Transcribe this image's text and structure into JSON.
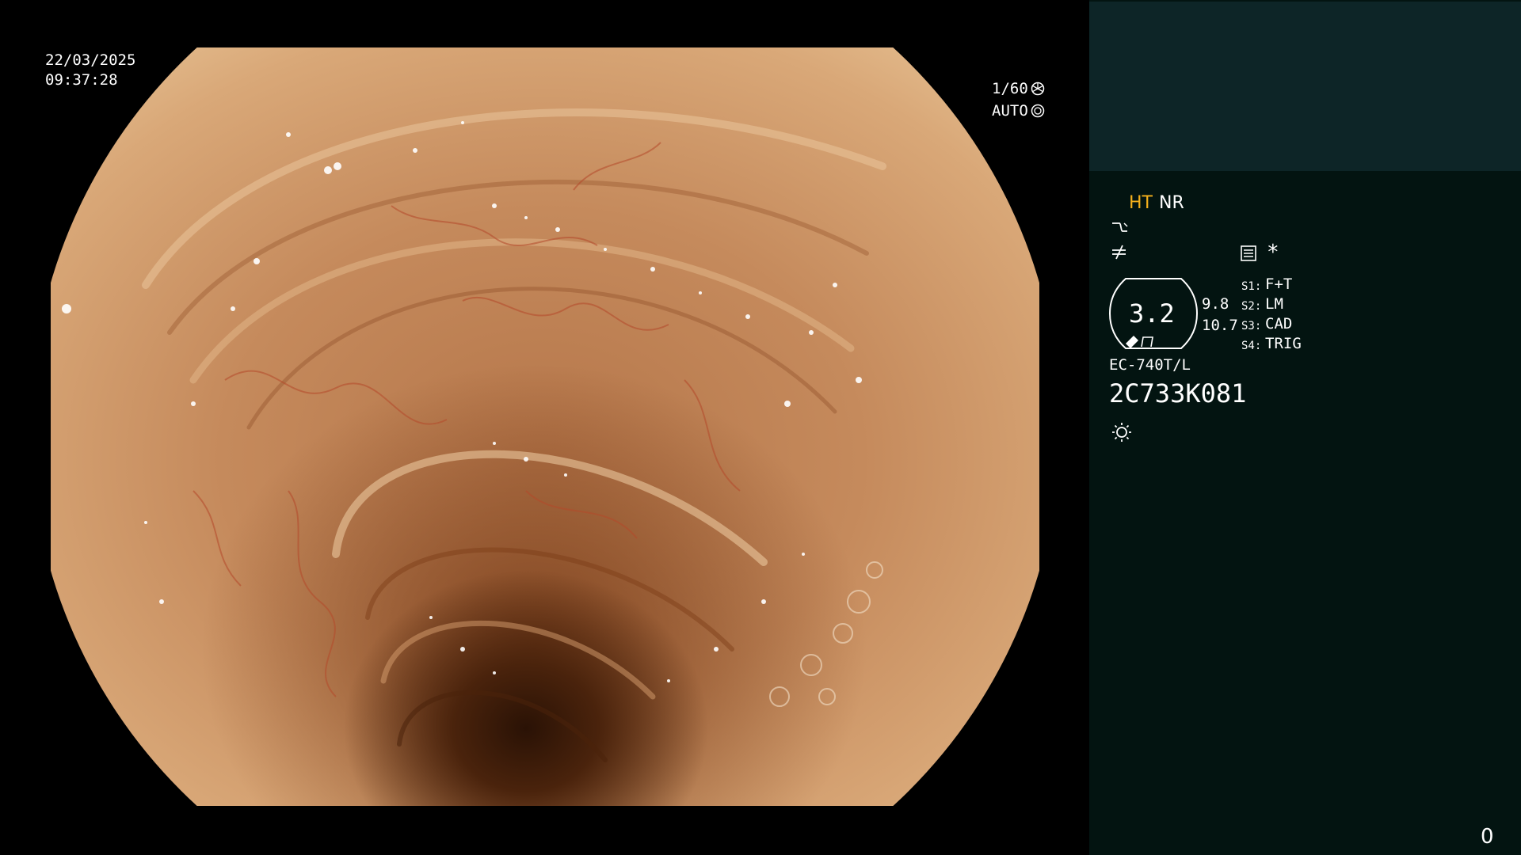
{
  "viewport": {
    "date": "22/03/2025",
    "time": "09:37:28",
    "shutter": "1/60",
    "iris": "AUTO",
    "shutter_icon": "aperture-icon",
    "iris_icon": "target-icon"
  },
  "panel": {
    "mode_ht": "HT",
    "mode_nr": "NR",
    "icons": [
      "enhance-curve-icon",
      "not-equal-icon",
      "settings-list-icon",
      "asterisk-icon",
      "brightness-icon"
    ],
    "asterisk": "*",
    "zoom_value": "3.2",
    "zoom_side_top": "9.8",
    "zoom_side_bottom": "10.7",
    "switches": [
      {
        "key": "S1:",
        "value": "F+T"
      },
      {
        "key": "S2:",
        "value": "LM"
      },
      {
        "key": "S3:",
        "value": "CAD"
      },
      {
        "key": "S4:",
        "value": "TRIG"
      }
    ],
    "scope_model": "EC-740T/L",
    "serial": "2C733K081",
    "counter": "0"
  },
  "colors": {
    "panel_bg": "#031411",
    "panel_top": "#0d2527",
    "accent": "#f5b01c"
  }
}
